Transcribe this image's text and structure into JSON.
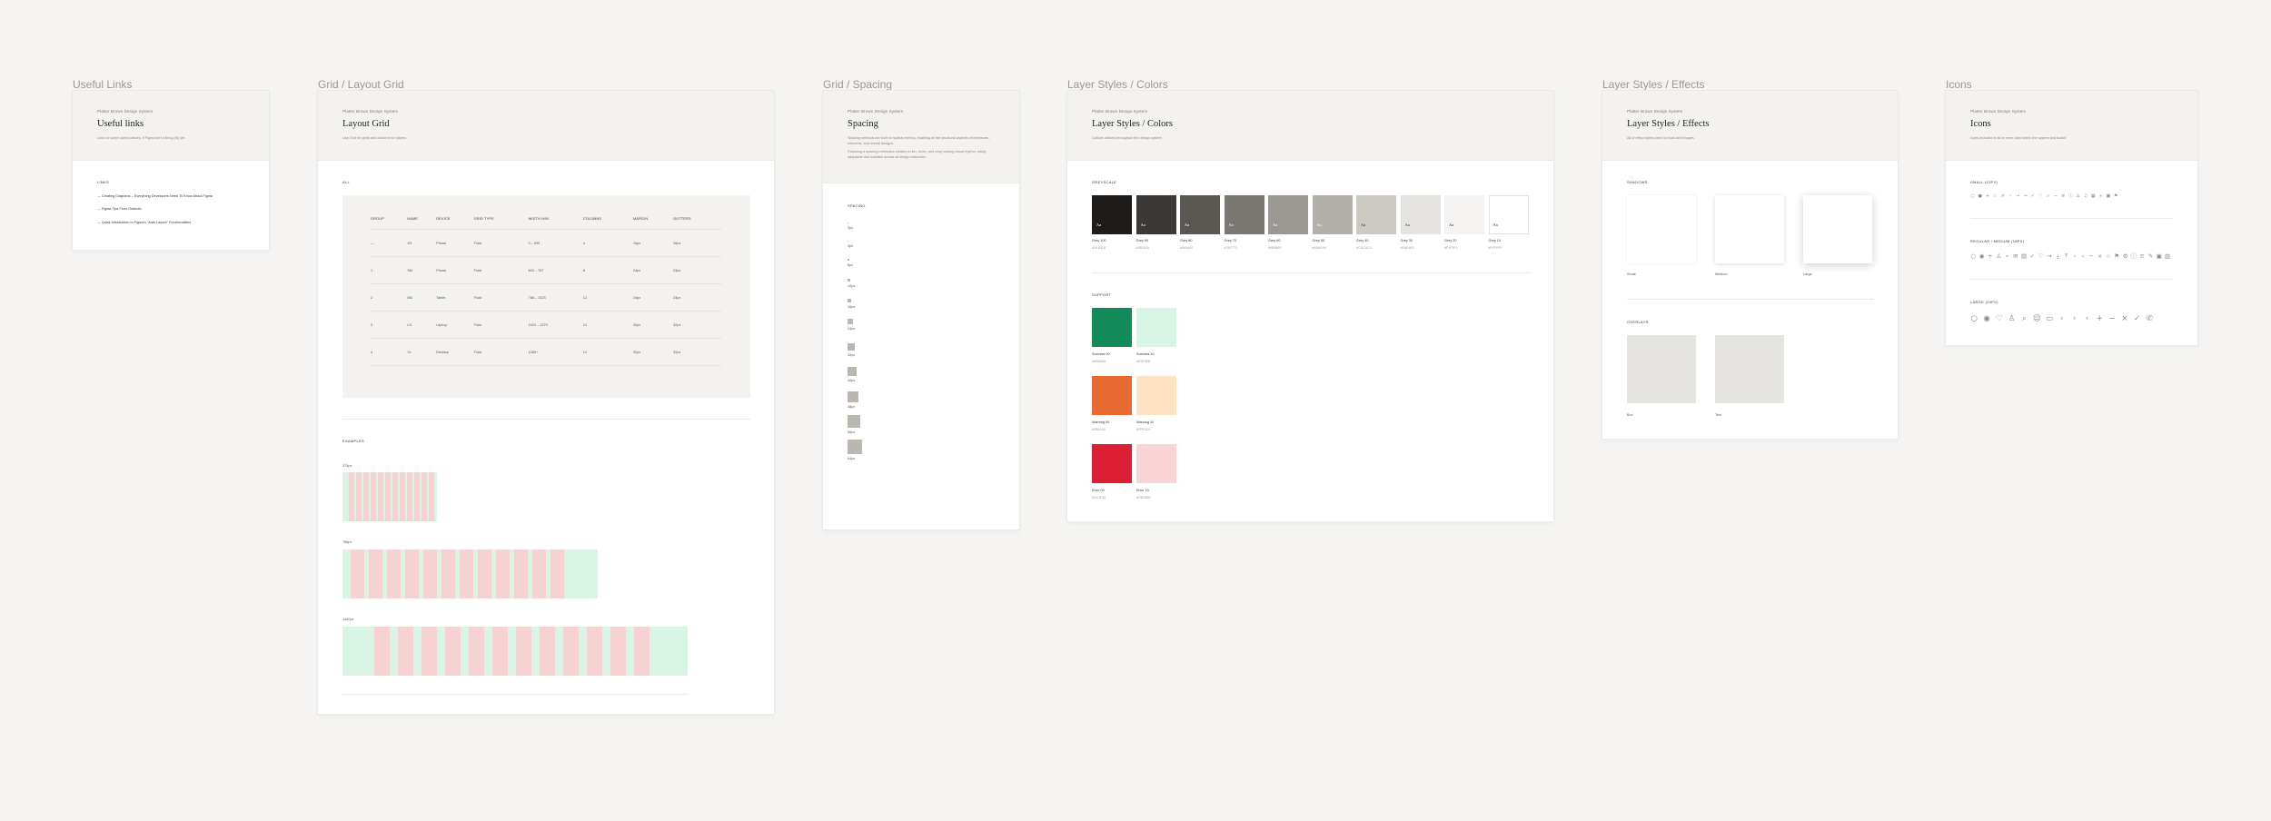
{
  "frame_labels": {
    "links": "Useful Links",
    "grid": "Grid / Layout Grid",
    "spacing": "Grid / Spacing",
    "colors": "Layer Styles / Colors",
    "effects": "Layer Styles / Effects",
    "icons": "Icons"
  },
  "eyebrow": "Platter Brown Design System",
  "links": {
    "title": "Useful links",
    "desc": "Links to some useful articles, if Figma isn't a thing (III) yet",
    "section": "LINKS",
    "items": [
      "→ Creating Diagrams – Everything Developers Need To Know About Figma",
      "→ Figma Tips From Dialectic",
      "→ Quick Introduction to Figma's \"Auto Layout\" Functionalities"
    ]
  },
  "grid": {
    "title": "Layout Grid",
    "desc": "Use Grid for grids and columns for tokens",
    "section1": "ALL",
    "columns": [
      "GROUP",
      "NAME",
      "DEVICE",
      "GRID TYPE",
      "WIDTH MIN",
      "COLUMNS",
      "MARGIN",
      "GUTTERS"
    ],
    "rows": [
      [
        "—",
        "XS",
        "Phone",
        "Fluid",
        "0 – 599",
        "4",
        "16px",
        "16px"
      ],
      [
        "1",
        "SM",
        "Phone",
        "Fluid",
        "600 – 767",
        "8",
        "24px",
        "24px"
      ],
      [
        "2",
        "MD",
        "Tablet",
        "Fluid",
        "768 – 1023",
        "12",
        "24px",
        "24px"
      ],
      [
        "3",
        "LG",
        "Laptop",
        "Fluid",
        "1024 – 1279",
        "12",
        "32px",
        "32px"
      ],
      [
        "4",
        "XL",
        "Desktop",
        "Fluid",
        "1280+",
        "12",
        "32px",
        "32px"
      ]
    ],
    "section2": "EXAMPLES",
    "examples": [
      "375px",
      "768px",
      "1440px"
    ]
  },
  "spacing": {
    "title": "Spacing",
    "desc1": "Spacing methods are built on spatial metrics, enabling all the structural aspects of interfaces, elements, and overall designs.",
    "desc2": "Following a spacing methodics creates a rich, clean, and crisp looking visual rhythm, easily adaptable and scalable across all design instances.",
    "section": "SPACING",
    "items": [
      "2px",
      "4px",
      "8px",
      "12px",
      "16px",
      "24px",
      "32px",
      "40px",
      "48px",
      "56px",
      "64px"
    ]
  },
  "colors": {
    "title": "Layer Styles  /  Colors",
    "desc": "Colours utilised throughout the design system",
    "section1": "GREYSCALE",
    "greys": [
      {
        "name": "Grey 100",
        "hex": "#1E1B18",
        "fill": "#1e1b18",
        "text": "#ffffff"
      },
      {
        "name": "Grey 90",
        "hex": "#3B3835",
        "fill": "#3b3835",
        "text": "#ffffff"
      },
      {
        "name": "Grey 80",
        "hex": "#5A5652",
        "fill": "#5a5652",
        "text": "#ffffff"
      },
      {
        "name": "Grey 70",
        "hex": "#7B7773",
        "fill": "#7b7773",
        "text": "#ffffff"
      },
      {
        "name": "Grey 60",
        "hex": "#9B9893",
        "fill": "#9b9893",
        "text": "#ffffff"
      },
      {
        "name": "Grey 50",
        "hex": "#B3AFA9",
        "fill": "#b3afa9",
        "text": "#ffffff"
      },
      {
        "name": "Grey 40",
        "hex": "#CDCAC4",
        "fill": "#cdcac4",
        "text": "#333333"
      },
      {
        "name": "Grey 30",
        "hex": "#E6E4E0",
        "fill": "#e6e4e0",
        "text": "#333333"
      },
      {
        "name": "Grey 20",
        "hex": "#F4F3F1",
        "fill": "#f4f3f1",
        "text": "#333333"
      },
      {
        "name": "Grey 10",
        "hex": "#FFFFFF",
        "fill": "#ffffff",
        "text": "#333333"
      }
    ],
    "swatch_text": "Aa",
    "section2": "SUPPORT",
    "support": [
      {
        "name": "Success 00",
        "hex": "#0E8A5A",
        "fill": "#138a5a"
      },
      {
        "name": "Success 10",
        "hex": "#D9F5E6",
        "fill": "#d8f4e5"
      },
      {
        "name": "Warning 00",
        "hex": "#E56A35",
        "fill": "#e86a33"
      },
      {
        "name": "Warning 10",
        "hex": "#FFE3C4",
        "fill": "#fde2c4"
      },
      {
        "name": "Error 00",
        "hex": "#DC1F32",
        "fill": "#dc1f32"
      },
      {
        "name": "Error 10",
        "hex": "#F8D3D6",
        "fill": "#f8d4d6"
      }
    ]
  },
  "effects": {
    "title": "Layer Styles  /  Effects",
    "desc": "All of effect styles used on tools and images",
    "section1": "SHADOWS",
    "shadows": [
      "Small",
      "Medium",
      "Large"
    ],
    "section2": "OVERLAYS",
    "overlays": [
      "Box",
      "Text"
    ]
  },
  "icons": {
    "title": "Icons",
    "desc": "Icons included in all or more used within the system and toolkit",
    "section1": "SMALL (12PX)",
    "small": [
      "circle-icon",
      "dot-icon",
      "plus-icon",
      "star-icon",
      "close-icon",
      "chevron-icon",
      "arrow-icon",
      "arrow-icon",
      "check-icon",
      "heart-icon",
      "search-icon",
      "minus-icon",
      "menu-icon",
      "info-icon",
      "user-icon",
      "bell-icon",
      "grid-icon",
      "link-icon",
      "lock-icon",
      "flag-icon"
    ],
    "section2": "REGULAR / MEDIUM (16PX)",
    "medium": [
      "circle-icon",
      "target-icon",
      "plus-icon",
      "user-icon",
      "search-icon",
      "mail-icon",
      "calendar-icon",
      "check-icon",
      "heart-icon",
      "arrow-icon",
      "download-icon",
      "upload-icon",
      "chevron-icon",
      "chevron-icon",
      "minus-icon",
      "close-icon",
      "star-icon",
      "flag-icon",
      "settings-icon",
      "info-icon",
      "menu-icon",
      "edit-icon",
      "lock-icon",
      "trash-icon"
    ],
    "section3": "LARGE (24PX)",
    "large": [
      "circle-icon",
      "target-icon",
      "heart-icon",
      "user-icon",
      "search-icon",
      "emoji-icon",
      "card-icon",
      "chevron-icon",
      "chevron-icon",
      "chevron-icon",
      "plus-icon",
      "minus-icon",
      "close-icon",
      "check-icon",
      "phone-icon"
    ]
  }
}
